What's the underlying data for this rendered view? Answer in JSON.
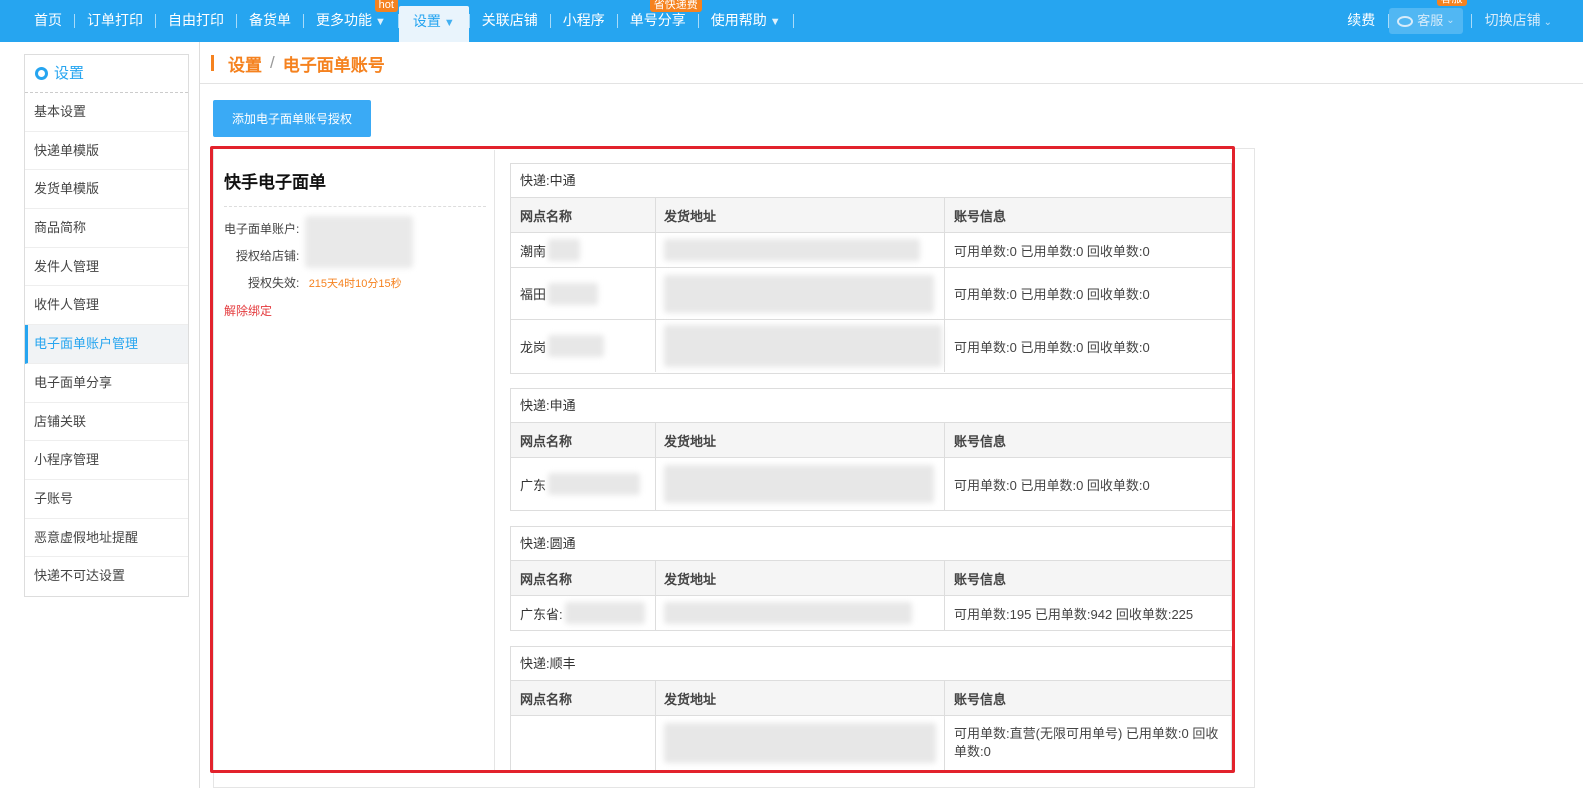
{
  "nav": {
    "items": [
      {
        "label": "首页"
      },
      {
        "label": "订单打印"
      },
      {
        "label": "自由打印"
      },
      {
        "label": "备货单"
      },
      {
        "label": "更多功能",
        "caret": "▼",
        "badge": "hot"
      },
      {
        "label": "设置",
        "caret": "▼",
        "active": true
      },
      {
        "label": "关联店铺"
      },
      {
        "label": "小程序"
      },
      {
        "label": "单号分享",
        "badge": "省快递费"
      },
      {
        "label": "使用帮助",
        "caret": "▼"
      }
    ],
    "right": {
      "renew": "续费",
      "service": "客服",
      "service_badge": "客服",
      "switch_store": "切换店铺"
    }
  },
  "sidebar": {
    "title": "设置",
    "items": [
      "基本设置",
      "快递单模版",
      "发货单模版",
      "商品简称",
      "发件人管理",
      "收件人管理",
      "电子面单账户管理",
      "电子面单分享",
      "店铺关联",
      "小程序管理",
      "子账号",
      "恶意虚假地址提醒",
      "快递不可达设置"
    ],
    "active_index": 6
  },
  "breadcrumb": {
    "root": "设置",
    "sep": "/",
    "current": "电子面单账号"
  },
  "add_button": "添加电子面单账号授权",
  "account": {
    "title": "快手电子面单",
    "account_label": "电子面单账户:",
    "store_label": "授权给店铺:",
    "expire_label": "授权失效:",
    "expire_value": "215天4时10分15秒",
    "unbind": "解除绑定"
  },
  "columns": {
    "branch": "网点名称",
    "address": "发货地址",
    "info": "账号信息"
  },
  "couriers": [
    {
      "name": "快递:中通",
      "rows": [
        {
          "branch": "潮南",
          "info": "可用单数:0 已用单数:0 回收单数:0"
        },
        {
          "branch": "福田",
          "info": "可用单数:0 已用单数:0 回收单数:0"
        },
        {
          "branch": "龙岗",
          "info": "可用单数:0 已用单数:0 回收单数:0"
        }
      ]
    },
    {
      "name": "快递:申通",
      "rows": [
        {
          "branch": "广东",
          "info": "可用单数:0 已用单数:0 回收单数:0"
        }
      ]
    },
    {
      "name": "快递:圆通",
      "rows": [
        {
          "branch": "广东省:",
          "info": "可用单数:195 已用单数:942 回收单数:225"
        }
      ]
    },
    {
      "name": "快递:顺丰",
      "rows": [
        {
          "branch": "",
          "info": "可用单数:直营(无限可用单号) 已用单数:0 回收单数:0"
        }
      ]
    }
  ],
  "colors": {
    "nav_bg": "#26a5f0",
    "accent_orange": "#f5821f",
    "highlight_red": "#e2222c",
    "danger": "#e4393c"
  }
}
